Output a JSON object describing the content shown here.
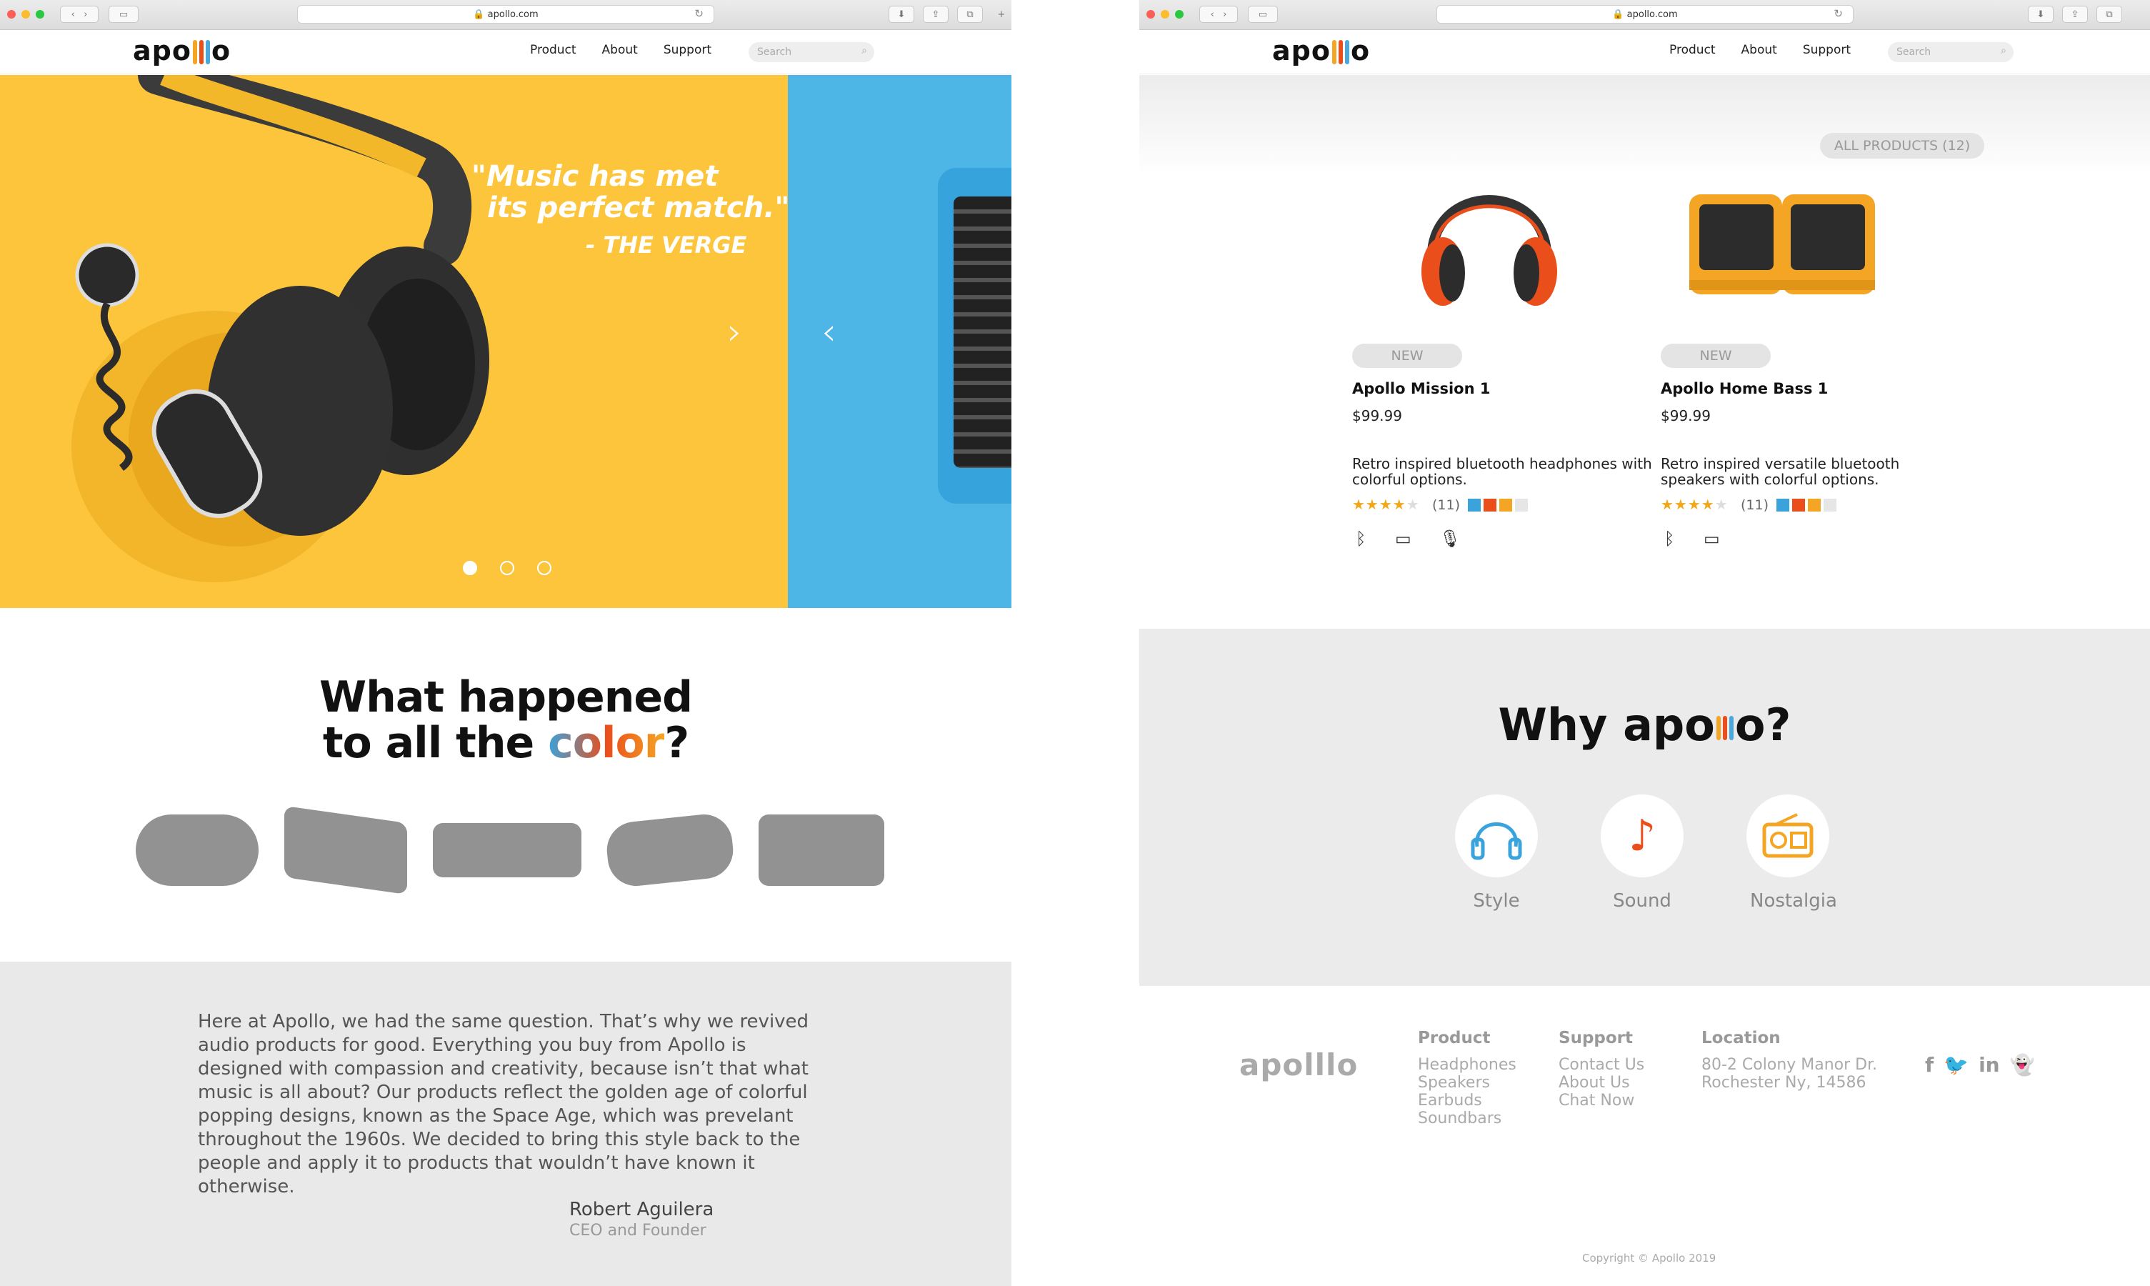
{
  "browser": {
    "url": "apollo.com"
  },
  "brand": {
    "logo_left": "apo",
    "logo_right": "o",
    "logo_gray": "apolllo",
    "bar_colors": [
      "#f5a524",
      "#e94e1b",
      "#4aa8dd"
    ]
  },
  "nav": {
    "product": "Product",
    "about": "About",
    "support": "Support",
    "search_placeholder": "Search"
  },
  "hero": {
    "quote_line1": "\"Music has met",
    "quote_line2": "its perfect match.\"",
    "quote_source": "- THE VERGE",
    "next_icon": "chevron-right-icon",
    "prev_icon": "chevron-left-icon",
    "slide_count": 3,
    "active_slide": 1
  },
  "section_color": {
    "line1": "What happened",
    "line2_a": "to all the ",
    "line2_b": "color",
    "line2_c": "?"
  },
  "story": {
    "text": "Here at Apollo, we had the same question. That’s why we revived audio products for good. Everything you buy from Apollo is designed with compassion and creativity, because isn’t that what music is all about? Our products reflect the golden age of colorful popping designs, known as the Space Age, which was prevelant throughout the 1960s. We decided to bring this style back to the people and apply it to products that wouldn’t have known it otherwise.",
    "name": "Robert Aguilera",
    "role": "CEO and Founder"
  },
  "products_page": {
    "all_products": "ALL PRODUCTS (12)",
    "items": [
      {
        "badge": "NEW",
        "name": "Apollo Mission 1",
        "price": "$99.99",
        "desc": "Retro inspired bluetooth headphones with colorful options.",
        "rating": 4,
        "reviews": "(11)",
        "colors": [
          "#3aa3dc",
          "#e94e1b",
          "#f5a524",
          "#e6e6e6"
        ],
        "features": [
          "bluetooth-icon",
          "battery-icon",
          "microphone-icon"
        ]
      },
      {
        "badge": "NEW",
        "name": "Apollo Home Bass 1",
        "price": "$99.99",
        "desc": "Retro inspired versatile bluetooth speakers with colorful options.",
        "rating": 4,
        "reviews": "(11)",
        "colors": [
          "#3aa3dc",
          "#e94e1b",
          "#f5a524",
          "#e6e6e6"
        ],
        "features": [
          "bluetooth-icon",
          "battery-icon"
        ]
      }
    ]
  },
  "why": {
    "title_a": "Why ",
    "title_b": "?",
    "items": [
      {
        "label": "Style",
        "icon": "headphones-icon"
      },
      {
        "label": "Sound",
        "icon": "music-note-icon"
      },
      {
        "label": "Nostalgia",
        "icon": "radio-icon"
      }
    ]
  },
  "footer": {
    "product_h": "Product",
    "product": [
      "Headphones",
      "Speakers",
      "Earbuds",
      "Soundbars"
    ],
    "support_h": "Support",
    "support": [
      "Contact Us",
      "About Us",
      "Chat Now"
    ],
    "location_h": "Location",
    "location": [
      "80-2 Colony Manor Dr.",
      "Rochester Ny, 14586"
    ],
    "social": [
      "facebook-icon",
      "twitter-icon",
      "linkedin-icon",
      "snapchat-icon"
    ],
    "copyright": "Copyright © Apollo 2019"
  }
}
